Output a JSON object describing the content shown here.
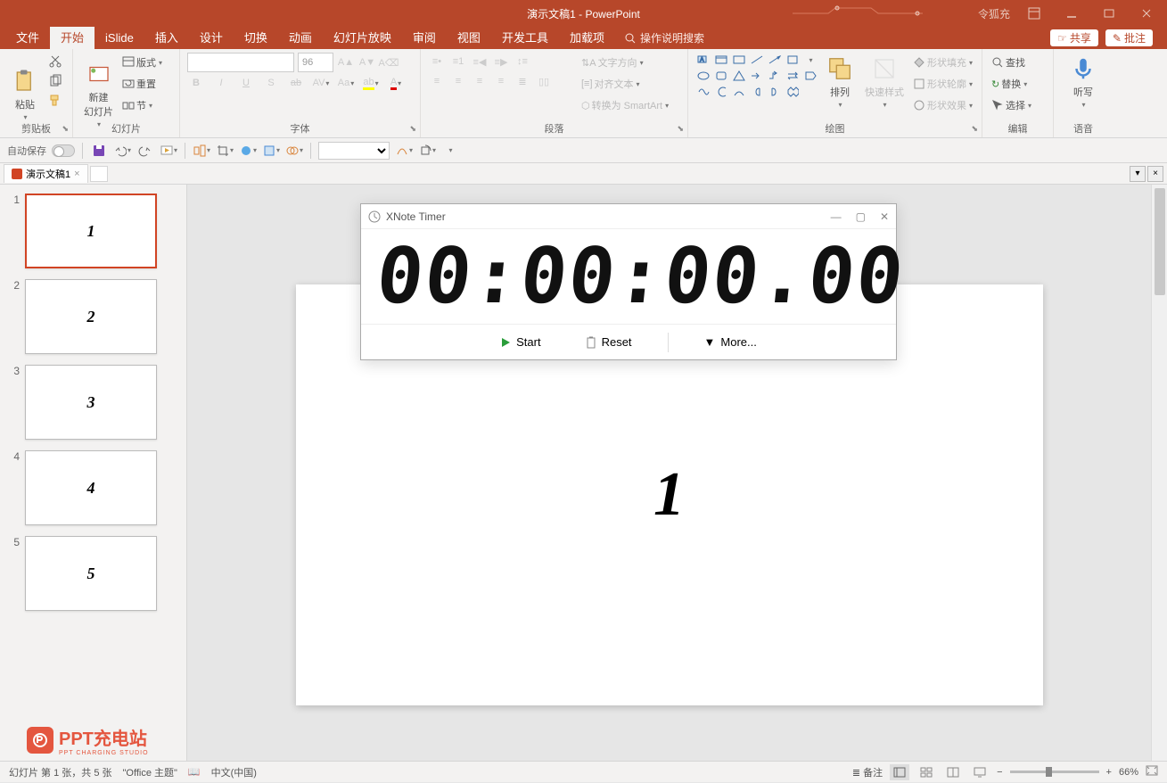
{
  "titlebar": {
    "title": "演示文稿1  -  PowerPoint",
    "user": "令狐充"
  },
  "menu": {
    "file": "文件",
    "home": "开始",
    "islide": "iSlide",
    "insert": "插入",
    "design": "设计",
    "transitions": "切换",
    "animations": "动画",
    "slideshow": "幻灯片放映",
    "review": "审阅",
    "view": "视图",
    "devtools": "开发工具",
    "addins": "加载项",
    "search_placeholder": "操作说明搜索",
    "share": "共享",
    "comments": "批注"
  },
  "ribbon": {
    "clipboard": {
      "label": "剪贴板",
      "paste": "粘贴"
    },
    "slides": {
      "label": "幻灯片",
      "new": "新建\n幻灯片",
      "layout": "版式",
      "reset": "重置",
      "section": "节"
    },
    "font": {
      "label": "字体",
      "size": "96"
    },
    "paragraph": {
      "label": "段落",
      "direction": "文字方向",
      "align": "对齐文本",
      "smartart": "转换为 SmartArt"
    },
    "drawing": {
      "label": "绘图",
      "arrange": "排列",
      "quick": "快速样式",
      "fill": "形状填充",
      "outline": "形状轮廓",
      "effects": "形状效果"
    },
    "editing": {
      "label": "编辑",
      "find": "查找",
      "replace": "替换",
      "select": "选择"
    },
    "voice": {
      "label": "语音",
      "dictate": "听写"
    }
  },
  "qat": {
    "autosave": "自动保存"
  },
  "doctab": {
    "name": "演示文稿1"
  },
  "thumbs": [
    {
      "num": "1",
      "content": "1",
      "active": true
    },
    {
      "num": "2",
      "content": "2",
      "active": false
    },
    {
      "num": "3",
      "content": "3",
      "active": false
    },
    {
      "num": "4",
      "content": "4",
      "active": false
    },
    {
      "num": "5",
      "content": "5",
      "active": false
    }
  ],
  "slide_content": "1",
  "xnote": {
    "title": "XNote Timer",
    "time": "00:00:00.00",
    "start": "Start",
    "reset": "Reset",
    "more": "More..."
  },
  "status": {
    "slide_info": "幻灯片 第 1 张，共 5 张",
    "theme": "\"Office 主题\"",
    "lang": "中文(中国)",
    "notes": "备注",
    "zoom": "66%"
  },
  "watermark": {
    "line1": "PPT充电站",
    "line2": "PPT CHARGING STUDIO"
  }
}
